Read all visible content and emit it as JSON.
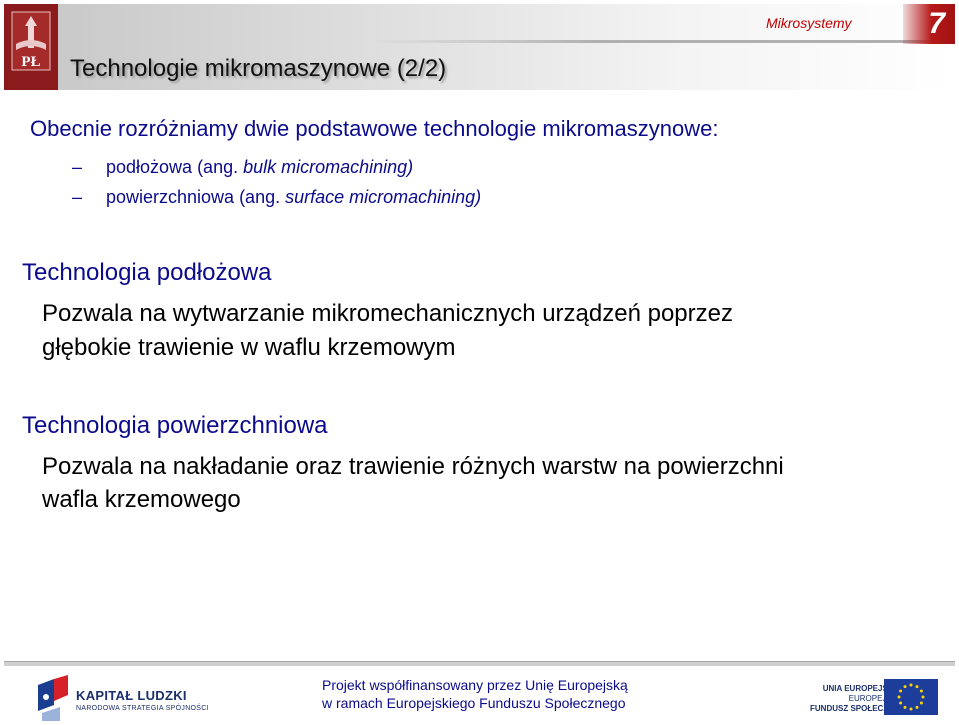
{
  "header": {
    "title": "Technologie mikromaszynowe (2/2)",
    "course": "Mikrosystemy",
    "page_number": "7",
    "logo_letters": "PŁ"
  },
  "intro": {
    "text": "Obecnie rozróżniamy dwie podstawowe technologie mikromaszynowe:",
    "items": [
      {
        "dash": "–",
        "text": "podłożowa (ang. ",
        "italic": "bulk micromachining)"
      },
      {
        "dash": "–",
        "text": "powierzchniowa (ang. ",
        "italic": "surface micromachining)"
      }
    ]
  },
  "sections": [
    {
      "heading": "Technologia podłożowa",
      "lines": [
        "Pozwala na wytwarzanie mikromechanicznych urządzeń poprzez",
        "głębokie trawienie w waflu krzemowym"
      ]
    },
    {
      "heading": "Technologia powierzchniowa",
      "lines": [
        "Pozwala na nakładanie oraz trawienie różnych warstw na powierzchni",
        "wafla krzemowego"
      ]
    }
  ],
  "footer": {
    "kl_title": "KAPITAŁ LUDZKI",
    "kl_subtitle": "NARODOWA STRATEGIA SPÓJNOŚCI",
    "cofinance_line1": "Projekt współfinansowany przez Unię Europejską",
    "cofinance_line2": "w ramach Europejskiego Funduszu Społecznego",
    "eu_line1": "UNIA EUROPEJSKA",
    "eu_line2": "EUROPEJSKI",
    "eu_line3": "FUNDUSZ SPOŁECZNY"
  }
}
